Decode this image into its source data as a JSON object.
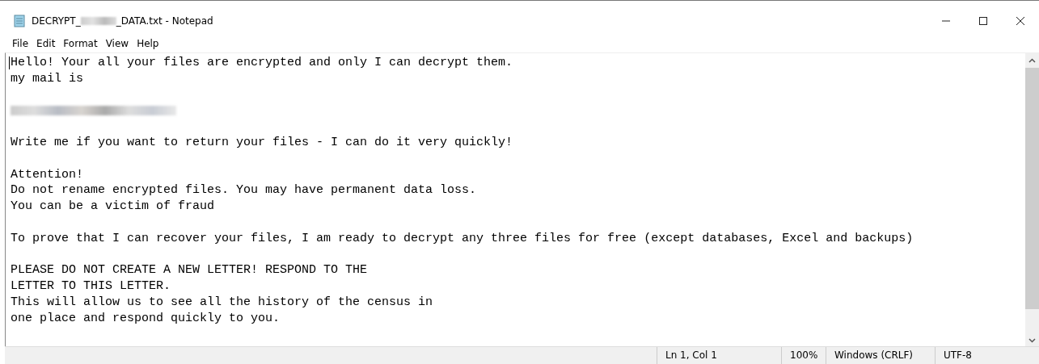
{
  "window": {
    "title_start": "DECRYPT_",
    "title_end": "_DATA.txt - Notepad"
  },
  "menu": [
    "File",
    "Edit",
    "Format",
    "View",
    "Help"
  ],
  "lines": [
    {
      "kind": "text",
      "text": "Hello! Your all your files are encrypted and only I can decrypt them."
    },
    {
      "kind": "text",
      "text": "my mail is"
    },
    {
      "kind": "blank"
    },
    {
      "kind": "redacted"
    },
    {
      "kind": "blank"
    },
    {
      "kind": "text",
      "text": "Write me if you want to return your files - I can do it very quickly!"
    },
    {
      "kind": "blank"
    },
    {
      "kind": "text",
      "text": "Attention!"
    },
    {
      "kind": "text",
      "text": "Do not rename encrypted files. You may have permanent data loss."
    },
    {
      "kind": "text",
      "text": "You can be a victim of fraud"
    },
    {
      "kind": "blank"
    },
    {
      "kind": "text",
      "text": "To prove that I can recover your files, I am ready to decrypt any three files for free (except databases, Excel and backups)"
    },
    {
      "kind": "blank"
    },
    {
      "kind": "text",
      "text": "PLEASE DO NOT CREATE A NEW LETTER! RESPOND TO THE"
    },
    {
      "kind": "text",
      "text": "LETTER TO THIS LETTER."
    },
    {
      "kind": "text",
      "text": "This will allow us to see all the history of the census in"
    },
    {
      "kind": "text",
      "text": "one place and respond quickly to you."
    }
  ],
  "status_bar": {
    "position": "Ln 1, Col 1",
    "zoom": "100%",
    "line_ending": "Windows (CRLF)",
    "encoding": "UTF-8"
  }
}
